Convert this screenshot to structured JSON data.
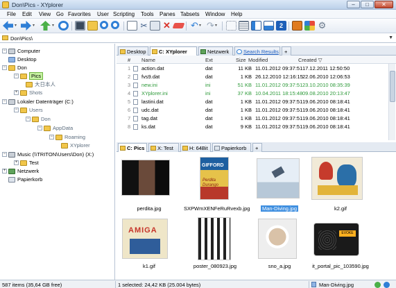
{
  "window": {
    "title": "Don\\Pics - XYplorer",
    "buttons": {
      "minimize": "–",
      "maximize": "□",
      "close": "✕"
    }
  },
  "menu": [
    "File",
    "Edit",
    "View",
    "Go",
    "Favorites",
    "User",
    "Scripting",
    "Tools",
    "Panes",
    "Tabsets",
    "Window",
    "Help"
  ],
  "address": {
    "value": "Don\\Pics\\",
    "dropdown": "▼"
  },
  "tree": {
    "computer": "Computer",
    "desktop": "Desktop",
    "don": "Don",
    "pics": "Pics",
    "japanese": "大日本人",
    "shots": "Shots",
    "local_drive": "Lokaler Datenträger (C:)",
    "users": "Users",
    "don2": "Don",
    "appdata": "AppData",
    "roaming": "Roaming",
    "xyplorer": "XYplorer",
    "music": "Music (\\\\TRITON\\Users\\Don) (X:)",
    "test": "Test",
    "network": "Netzwerk",
    "bin": "Papierkorb",
    "exp_plus": "+",
    "exp_minus": "−"
  },
  "tabs_top": [
    {
      "label": "Desktop"
    },
    {
      "label": "C: XYplorer"
    },
    {
      "label": "Netzwerk"
    },
    {
      "label": "Search Results"
    },
    {
      "label": "+"
    }
  ],
  "list": {
    "headers": {
      "num": "#",
      "name": "Name",
      "ext": "Ext",
      "size": "Size",
      "modified": "Modified",
      "created": "Created  ▽"
    },
    "rows": [
      {
        "num": "1",
        "name": "action.dat",
        "ext": "dat",
        "size": "11 KB",
        "modified": "11.01.2012 09:37:51",
        "created": "17.12.2011 12:50:50",
        "green": false
      },
      {
        "num": "2",
        "name": "fvs9.dat",
        "ext": "dat",
        "size": "1 KB",
        "modified": "26.12.2010 12:16:15",
        "created": "22.06.2010 12:06:53",
        "green": false
      },
      {
        "num": "3",
        "name": "new.ini",
        "ext": "ini",
        "size": "51 KB",
        "modified": "11.01.2012 09:37:51",
        "created": "23.10.2010 08:35:39",
        "green": true
      },
      {
        "num": "4",
        "name": "XYplorer.ini",
        "ext": "ini",
        "size": "37 KB",
        "modified": "10.04.2011 18:15:48",
        "created": "09.08.2010 20:13:47",
        "green": true
      },
      {
        "num": "5",
        "name": "lastini.dat",
        "ext": "dat",
        "size": "1 KB",
        "modified": "11.01.2012 09:37:51",
        "created": "19.06.2010 08:18:41",
        "green": false
      },
      {
        "num": "6",
        "name": "udc.dat",
        "ext": "dat",
        "size": "1 KB",
        "modified": "11.01.2012 09:37:51",
        "created": "19.06.2010 08:18:41",
        "green": false
      },
      {
        "num": "7",
        "name": "tag.dat",
        "ext": "dat",
        "size": "1 KB",
        "modified": "11.01.2012 09:37:51",
        "created": "19.06.2010 08:18:41",
        "green": false
      },
      {
        "num": "8",
        "name": "ks.dat",
        "ext": "dat",
        "size": "9 KB",
        "modified": "11.01.2012 09:37:51",
        "created": "19.06.2010 08:18:41",
        "green": false
      }
    ]
  },
  "tabs_bottom": [
    {
      "label": "C: Pics"
    },
    {
      "label": "X: Test"
    },
    {
      "label": "H: 64Bit"
    },
    {
      "label": "Papierkorb"
    },
    {
      "label": "+"
    }
  ],
  "thumbnails": [
    {
      "name": "perdita.jpg",
      "selected": false
    },
    {
      "name": "SXPWmXENFeRuRvexb.jpg",
      "selected": false
    },
    {
      "name": "Man-Diving.jpg",
      "selected": true
    },
    {
      "name": "k2.gif",
      "selected": false
    },
    {
      "name": "k1.gif",
      "selected": false
    },
    {
      "name": "poster_080923.jpg",
      "selected": false
    },
    {
      "name": "sno_a.jpg",
      "selected": false
    },
    {
      "name": "it_portal_pic_103590.jpg",
      "selected": false
    }
  ],
  "poster_text": {
    "gifford": "GIFFORD",
    "perdita": "Perdita Durango",
    "amiga": "AMIGA",
    "evoke": "EVOKE"
  },
  "status": {
    "items": "587 items (35,64 GB free)",
    "selected": "1 selected: 24,42 KB (25.004 bytes)",
    "file": "Man-Diving.jpg"
  },
  "colors": {
    "accent": "#3f8fe0",
    "green_file": "#2e9a3a",
    "tree_selected": "#c7f3a2"
  }
}
